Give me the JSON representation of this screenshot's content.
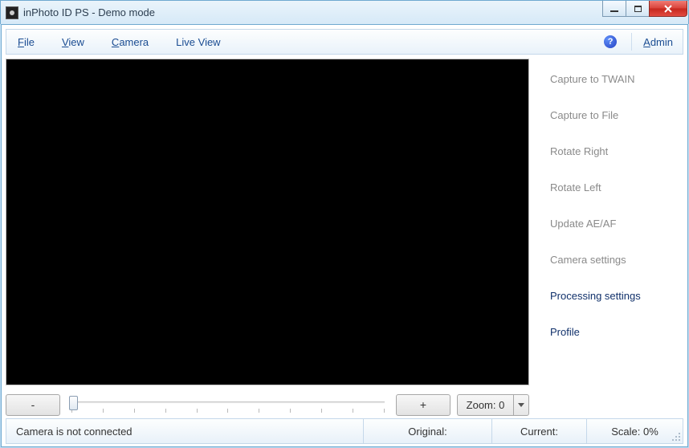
{
  "window": {
    "title": "inPhoto ID PS - Demo mode"
  },
  "menu": {
    "file": "File",
    "view": "View",
    "camera": "Camera",
    "live_view": "Live View",
    "admin": "Admin"
  },
  "side": {
    "capture_twain": "Capture to TWAIN",
    "capture_file": "Capture to File",
    "rotate_right": "Rotate Right",
    "rotate_left": "Rotate Left",
    "update_aeaf": "Update AE/AF",
    "camera_settings": "Camera settings",
    "processing_settings": "Processing settings",
    "profile": "Profile"
  },
  "zoom": {
    "minus": "-",
    "plus": "+",
    "label": "Zoom: 0",
    "value": 0,
    "tick_count": 11
  },
  "status": {
    "camera": "Camera is not connected",
    "original_label": "Original:",
    "original_value": "",
    "current_label": "Current:",
    "current_value": "",
    "scale_label": "Scale:",
    "scale_value": "0%"
  }
}
